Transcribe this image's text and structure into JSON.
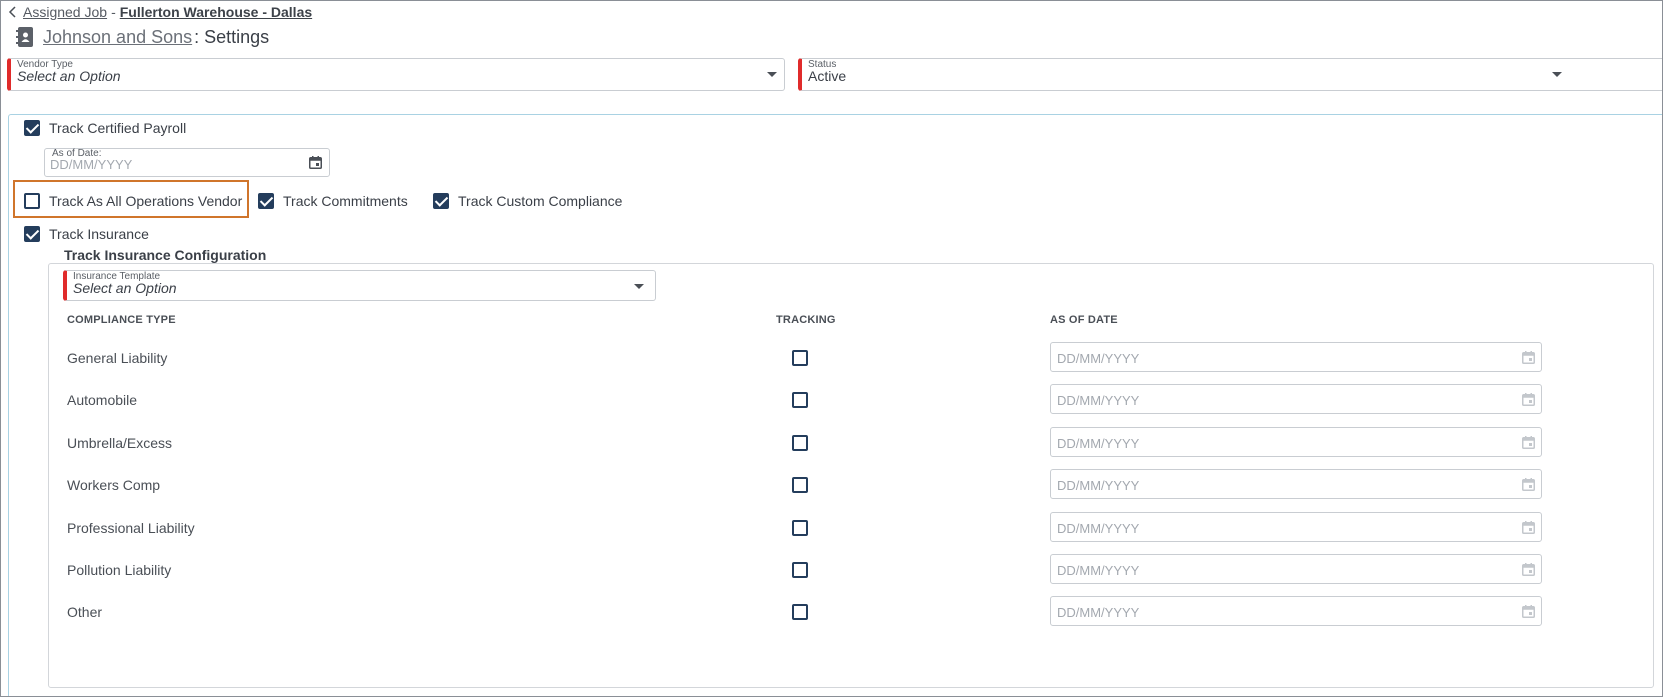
{
  "breadcrumb": {
    "link_label": "Assigned Job",
    "separator": "-",
    "job_name": "Fullerton Warehouse - Dallas"
  },
  "header": {
    "vendor_name": "Johnson and Sons",
    "suffix": ": Settings"
  },
  "vendor_type": {
    "label": "Vendor Type",
    "value": "Select an Option"
  },
  "status": {
    "label": "Status",
    "value": "Active"
  },
  "certified_payroll": {
    "label": "Track Certified Payroll",
    "checked": true,
    "as_of_label": "As of Date:",
    "as_of_placeholder": "DD/MM/YYYY"
  },
  "options": {
    "all_operations_label": "Track As All Operations Vendor",
    "all_operations_checked": false,
    "commitments_label": "Track Commitments",
    "commitments_checked": true,
    "custom_compliance_label": "Track Custom Compliance",
    "custom_compliance_checked": true
  },
  "insurance": {
    "label": "Track Insurance",
    "checked": true,
    "config_title": "Track Insurance Configuration",
    "template_label": "Insurance Template",
    "template_value": "Select an Option",
    "columns": {
      "type": "COMPLIANCE TYPE",
      "tracking": "TRACKING",
      "as_of_date": "AS OF DATE"
    },
    "rows": [
      {
        "type": "General Liability",
        "tracking": false,
        "date_placeholder": "DD/MM/YYYY"
      },
      {
        "type": "Automobile",
        "tracking": false,
        "date_placeholder": "DD/MM/YYYY"
      },
      {
        "type": "Umbrella/Excess",
        "tracking": false,
        "date_placeholder": "DD/MM/YYYY"
      },
      {
        "type": "Workers Comp",
        "tracking": false,
        "date_placeholder": "DD/MM/YYYY"
      },
      {
        "type": "Professional Liability",
        "tracking": false,
        "date_placeholder": "DD/MM/YYYY"
      },
      {
        "type": "Pollution Liability",
        "tracking": false,
        "date_placeholder": "DD/MM/YYYY"
      },
      {
        "type": "Other",
        "tracking": false,
        "date_placeholder": "DD/MM/YYYY"
      }
    ]
  },
  "colors": {
    "accent_navy": "#243d5c",
    "required_red": "#e02b2b",
    "highlight_orange": "#d0752b",
    "panel_border": "#a9d2e3"
  },
  "icons": [
    "chevron-left-icon",
    "address-book-icon",
    "calendar-icon",
    "caret-down-icon",
    "checkbox-icon"
  ]
}
